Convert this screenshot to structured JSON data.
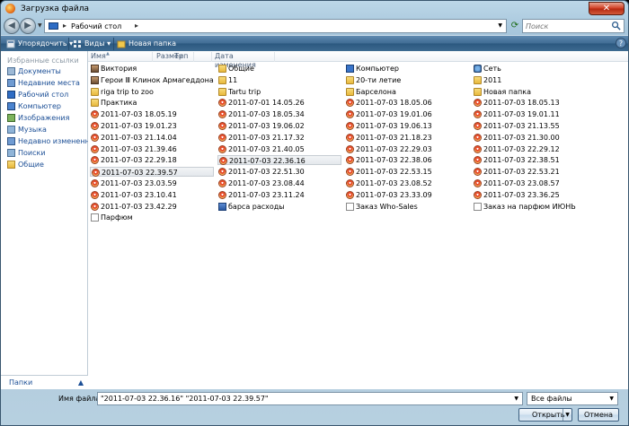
{
  "window": {
    "title": "Загрузка файла",
    "close_label": "✕"
  },
  "address": {
    "location": "Рабочий стол",
    "search_placeholder": "Поиск"
  },
  "toolbar": {
    "organize": "Упорядочить",
    "views": "Виды",
    "new_folder": "Новая папка",
    "help": "?"
  },
  "sidebar": {
    "header": "Избранные ссылки",
    "items": [
      "Документы",
      "Недавние места",
      "Рабочий стол",
      "Компьютер",
      "Изображения",
      "Музыка",
      "Недавно измененн...",
      "Поиски",
      "Общие"
    ],
    "folders_label": "Папки"
  },
  "columns": [
    "Имя",
    "Размер",
    "Тип",
    "Дата изменения"
  ],
  "files": [
    {
      "name": "Виктория",
      "icon": "person-icon"
    },
    {
      "name": "Герои Ⅲ Клинок Армагеддона",
      "icon": "person-icon"
    },
    {
      "name": "riga trip to zoo",
      "icon": "folder-icon"
    },
    {
      "name": "Практика",
      "icon": "folder-icon"
    },
    {
      "name": "2011-07-03 18.05.19",
      "icon": "image-icon"
    },
    {
      "name": "2011-07-03 19.01.23",
      "icon": "image-icon"
    },
    {
      "name": "2011-07-03 21.14.04",
      "icon": "image-icon"
    },
    {
      "name": "2011-07-03 21.39.46",
      "icon": "image-icon"
    },
    {
      "name": "2011-07-03 22.29.18",
      "icon": "image-icon"
    },
    {
      "name": "2011-07-03 22.39.57",
      "icon": "image-icon"
    },
    {
      "name": "2011-07-03 23.03.59",
      "icon": "image-icon"
    },
    {
      "name": "2011-07-03 23.10.41",
      "icon": "image-icon"
    },
    {
      "name": "2011-07-03 23.42.29",
      "icon": "image-icon"
    },
    {
      "name": "Парфюм",
      "icon": "document-icon"
    },
    {
      "name": "Общие",
      "icon": "folder-icon"
    },
    {
      "name": "11",
      "icon": "folder-icon"
    },
    {
      "name": "Tartu trip",
      "icon": "folder-icon"
    },
    {
      "name": "2011-07-01 14.05.26",
      "icon": "image-icon"
    },
    {
      "name": "2011-07-03 18.05.34",
      "icon": "image-icon"
    },
    {
      "name": "2011-07-03 19.06.02",
      "icon": "image-icon"
    },
    {
      "name": "2011-07-03 21.17.32",
      "icon": "image-icon"
    },
    {
      "name": "2011-07-03 21.40.05",
      "icon": "image-icon"
    },
    {
      "name": "2011-07-03 22.36.16",
      "icon": "image-icon"
    },
    {
      "name": "2011-07-03 22.51.30",
      "icon": "image-icon"
    },
    {
      "name": "2011-07-03 23.08.44",
      "icon": "image-icon"
    },
    {
      "name": "2011-07-03 23.11.24",
      "icon": "image-icon"
    },
    {
      "name": "барса расходы",
      "icon": "spreadsheet-icon"
    },
    {
      "name": "Компьютер",
      "icon": "computer-icon"
    },
    {
      "name": "20-ти летие",
      "icon": "folder-icon"
    },
    {
      "name": "Барселона",
      "icon": "folder-icon"
    },
    {
      "name": "2011-07-03 18.05.06",
      "icon": "image-icon"
    },
    {
      "name": "2011-07-03 19.01.06",
      "icon": "image-icon"
    },
    {
      "name": "2011-07-03 19.06.13",
      "icon": "image-icon"
    },
    {
      "name": "2011-07-03 21.18.23",
      "icon": "image-icon"
    },
    {
      "name": "2011-07-03 22.29.03",
      "icon": "image-icon"
    },
    {
      "name": "2011-07-03 22.38.06",
      "icon": "image-icon"
    },
    {
      "name": "2011-07-03 22.53.15",
      "icon": "image-icon"
    },
    {
      "name": "2011-07-03 23.08.52",
      "icon": "image-icon"
    },
    {
      "name": "2011-07-03 23.33.09",
      "icon": "image-icon"
    },
    {
      "name": "Заказ Who-Sales",
      "icon": "document-icon"
    },
    {
      "name": "Сеть",
      "icon": "network-icon"
    },
    {
      "name": "2011",
      "icon": "folder-icon"
    },
    {
      "name": "Новая папка",
      "icon": "folder-icon"
    },
    {
      "name": "2011-07-03 18.05.13",
      "icon": "image-icon"
    },
    {
      "name": "2011-07-03 19.01.11",
      "icon": "image-icon"
    },
    {
      "name": "2011-07-03 21.13.55",
      "icon": "image-icon"
    },
    {
      "name": "2011-07-03 21.30.00",
      "icon": "image-icon"
    },
    {
      "name": "2011-07-03 22.29.12",
      "icon": "image-icon"
    },
    {
      "name": "2011-07-03 22.38.51",
      "icon": "image-icon"
    },
    {
      "name": "2011-07-03 22.53.21",
      "icon": "image-icon"
    },
    {
      "name": "2011-07-03 23.08.57",
      "icon": "image-icon"
    },
    {
      "name": "2011-07-03 23.36.25",
      "icon": "image-icon"
    },
    {
      "name": "Заказ на парфюм ИЮНЬ",
      "icon": "document-icon"
    }
  ],
  "bottom": {
    "filename_label": "Имя файла:",
    "filename_value": "\"2011-07-03 22.36.16\" \"2011-07-03 22.39.57\"",
    "filter": "Все файлы",
    "open": "Открыть",
    "cancel": "Отмена"
  }
}
